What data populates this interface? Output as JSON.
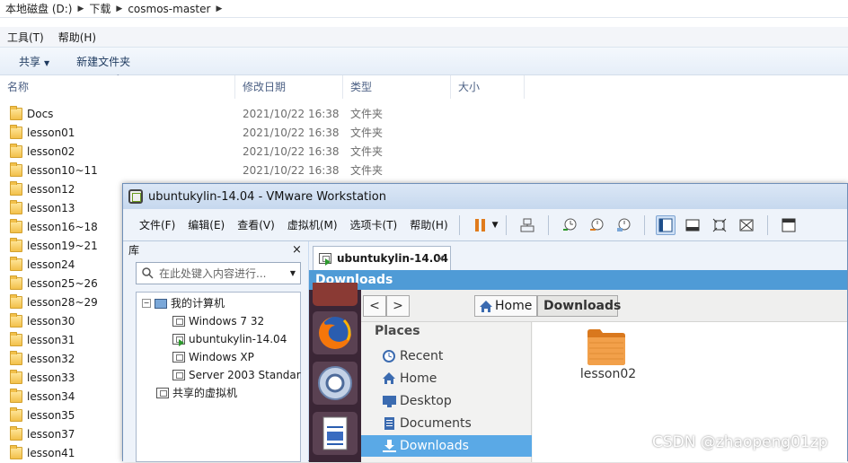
{
  "explorer": {
    "breadcrumb": [
      "本地磁盘 (D:)",
      "下载",
      "cosmos-master"
    ],
    "menu": [
      "工具(T)",
      "帮助(H)"
    ],
    "commands": {
      "share": "共享",
      "new_folder": "新建文件夹"
    },
    "columns": [
      "名称",
      "修改日期",
      "类型",
      "大小"
    ],
    "files": [
      {
        "name": "Docs",
        "date": "2021/10/22 16:38",
        "type": "文件夹"
      },
      {
        "name": "lesson01",
        "date": "2021/10/22 16:38",
        "type": "文件夹"
      },
      {
        "name": "lesson02",
        "date": "2021/10/22 16:38",
        "type": "文件夹"
      },
      {
        "name": "lesson10~11",
        "date": "2021/10/22 16:38",
        "type": "文件夹"
      },
      {
        "name": "lesson12",
        "date": "",
        "type": ""
      },
      {
        "name": "lesson13",
        "date": "",
        "type": ""
      },
      {
        "name": "lesson16~18",
        "date": "",
        "type": ""
      },
      {
        "name": "lesson19~21",
        "date": "",
        "type": ""
      },
      {
        "name": "lesson24",
        "date": "",
        "type": ""
      },
      {
        "name": "lesson25~26",
        "date": "",
        "type": ""
      },
      {
        "name": "lesson28~29",
        "date": "",
        "type": ""
      },
      {
        "name": "lesson30",
        "date": "",
        "type": ""
      },
      {
        "name": "lesson31",
        "date": "",
        "type": ""
      },
      {
        "name": "lesson32",
        "date": "",
        "type": ""
      },
      {
        "name": "lesson33",
        "date": "",
        "type": ""
      },
      {
        "name": "lesson34",
        "date": "",
        "type": ""
      },
      {
        "name": "lesson35",
        "date": "",
        "type": ""
      },
      {
        "name": "lesson37",
        "date": "",
        "type": ""
      },
      {
        "name": "lesson41",
        "date": "",
        "type": ""
      }
    ]
  },
  "vmware": {
    "title": "ubuntukylin-14.04 - VMware Workstation",
    "menu": [
      "文件(F)",
      "编辑(E)",
      "查看(V)",
      "虚拟机(M)",
      "选项卡(T)",
      "帮助(H)"
    ],
    "library": {
      "header": "库",
      "close": "×",
      "search_placeholder": "在此处键入内容进行...",
      "tree": {
        "root": "我的计算机",
        "vms": [
          "Windows 7 32",
          "ubuntukylin-14.04",
          "Windows XP",
          "Server 2003 Standar"
        ],
        "shared": "共享的虚拟机"
      }
    },
    "tab": {
      "label": "ubuntukylin-14.04",
      "close": "×"
    },
    "guest": {
      "window_title": "Downloads",
      "nav": {
        "back": "<",
        "forward": ">"
      },
      "path": [
        "Home",
        "Downloads"
      ],
      "places_header": "Places",
      "places": [
        "Recent",
        "Home",
        "Desktop",
        "Documents",
        "Downloads"
      ],
      "active_place": "Downloads",
      "folder": "lesson02"
    }
  },
  "watermark": "CSDN @zhaopeng01zp",
  "colors": {
    "ubuntu_title": "#4f9bd6",
    "selected_place": "#5aa9e6",
    "launcher": "#3b2636",
    "vmware_chrome": "#c9daf0"
  }
}
